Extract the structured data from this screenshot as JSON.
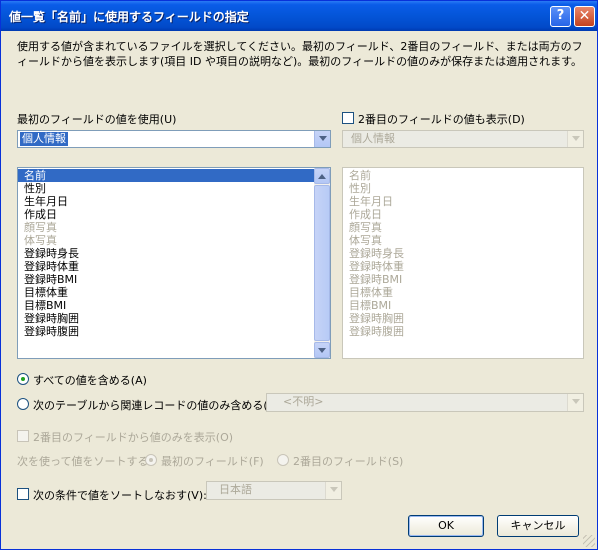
{
  "window": {
    "title": "値一覧「名前」に使用するフィールドの指定"
  },
  "description": "使用する値が含まれているファイルを選択してください。最初のフィールド、2番目のフィールド、または両方のフィールドから値を表示します(項目 ID や項目の説明など)。最初のフィールドの値のみが保存または適用されます。",
  "first_field": {
    "label": "最初のフィールドの値を使用(U)",
    "table_value": "個人情報",
    "items": [
      {
        "label": "名前",
        "state": "selected"
      },
      {
        "label": "性別",
        "state": "normal"
      },
      {
        "label": "生年月日",
        "state": "normal"
      },
      {
        "label": "作成日",
        "state": "normal"
      },
      {
        "label": "顔写真",
        "state": "disabled"
      },
      {
        "label": "体写真",
        "state": "disabled"
      },
      {
        "label": "登録時身長",
        "state": "normal"
      },
      {
        "label": "登録時体重",
        "state": "normal"
      },
      {
        "label": "登録時BMI",
        "state": "normal"
      },
      {
        "label": "目標体重",
        "state": "normal"
      },
      {
        "label": "目標BMI",
        "state": "normal"
      },
      {
        "label": "登録時胸囲",
        "state": "normal"
      },
      {
        "label": "登録時腹囲",
        "state": "normal"
      }
    ]
  },
  "second_field": {
    "checkbox_label": "2番目のフィールドの値も表示(D)",
    "checked": false,
    "table_value": "個人情報",
    "items": [
      "名前",
      "性別",
      "生年月日",
      "作成日",
      "顔写真",
      "体写真",
      "登録時身長",
      "登録時体重",
      "登録時BMI",
      "目標体重",
      "目標BMI",
      "登録時胸囲",
      "登録時腹囲"
    ]
  },
  "include": {
    "all_values_label": "すべての値を含める(A)",
    "related_label": "次のテーブルから関連レコードの値のみ含める(R):",
    "related_value": "<不明>"
  },
  "show_second_only_label": "2番目のフィールドから値のみを表示(O)",
  "sort": {
    "by_label": "次を使って値をソートする:",
    "first_label": "最初のフィールド(F)",
    "second_label": "2番目のフィールド(S)",
    "resort_label": "次の条件で値をソートしなおす(V):",
    "language_value": "日本語"
  },
  "buttons": {
    "ok": "OK",
    "cancel": "キャンセル"
  },
  "colors": {
    "titlebar": "#0455d8",
    "selection": "#316ac5",
    "dialog_bg": "#ece9d8",
    "disabled_text": "#aca899"
  }
}
